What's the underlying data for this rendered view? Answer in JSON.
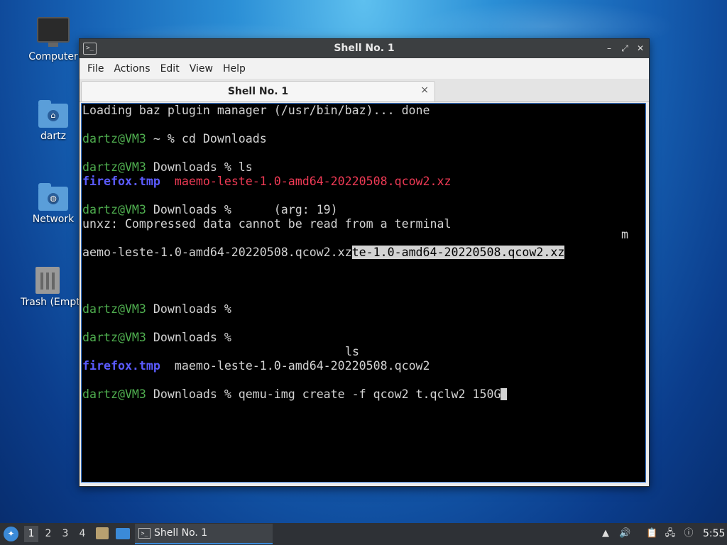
{
  "desktop": {
    "icons": [
      {
        "label": "Computer"
      },
      {
        "label": "dartz"
      },
      {
        "label": "Network"
      },
      {
        "label": "Trash (Empty)"
      }
    ]
  },
  "window": {
    "title": "Shell No. 1",
    "menu": [
      "File",
      "Actions",
      "Edit",
      "View",
      "Help"
    ],
    "tab_title": "Shell No. 1",
    "tab_close": "×",
    "controls": {
      "minimize": "–",
      "maximize": "⤢",
      "close": "✕"
    }
  },
  "terminal": {
    "prompt_user_host": "dartz@VM3",
    "line1": "Loading baz plugin manager (/usr/bin/baz)... done",
    "cmd1": " ~ % cd Downloads",
    "cmd2": " Downloads % ls",
    "ls1_file1": "firefox.tmp",
    "ls1_sep": "  ",
    "ls1_file2": "maemo-leste-1.0-amd64-20220508.qcow2.xz",
    "cmd3": " Downloads %      (arg: 19)",
    "err": "unxz: Compressed data cannot be read from a terminal",
    "stray_m": "m",
    "garbled_a": "aemo-leste-1.0-amd64-20220508.qcow2.xz",
    "garbled_sel": "te-1.0-amd64-20220508.qcow2.xz",
    "cmd4": " Downloads %",
    "cmd5": " Downloads %",
    "echo_ls": "ls",
    "ls2_file1": "firefox.tmp",
    "ls2_rest": "  maemo-leste-1.0-amd64-20220508.qcow2",
    "cmd6": " Downloads % qemu-img create -f qcow2 t.qclw2 150G"
  },
  "taskbar": {
    "workspaces": [
      "1",
      "2",
      "3",
      "4"
    ],
    "active_workspace": "1",
    "task_label": "Shell No. 1",
    "clock": "5:55"
  },
  "colors": {
    "prompt": "#4fae4f",
    "directory": "#5b5bff",
    "archive": "#ef3a55",
    "accent": "#3b8ad8"
  }
}
